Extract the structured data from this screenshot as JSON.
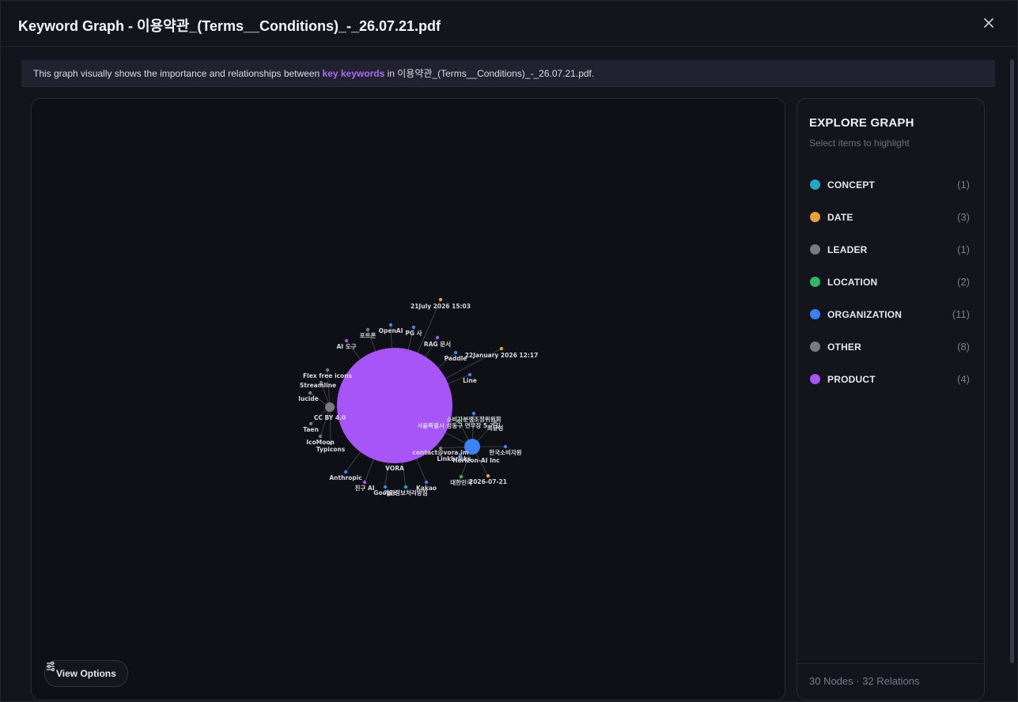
{
  "header": {
    "title": "Keyword Graph - 이용약관_(Terms__Conditions)_-_26.07.21.pdf"
  },
  "info": {
    "prefix": "This graph visually shows the importance and relationships between ",
    "highlight": "key keywords",
    "suffix": " in 이용약관_(Terms__Conditions)_-_26.07.21.pdf."
  },
  "view_options": {
    "label": "View Options"
  },
  "explore": {
    "title": "EXPLORE GRAPH",
    "subtitle": "Select items to highlight",
    "categories": [
      {
        "name": "CONCEPT",
        "count": "(1)",
        "color": "#22a6c5"
      },
      {
        "name": "DATE",
        "count": "(3)",
        "color": "#e8a13b"
      },
      {
        "name": "LEADER",
        "count": "(1)",
        "color": "#7a7a85"
      },
      {
        "name": "LOCATION",
        "count": "(2)",
        "color": "#2eb86b"
      },
      {
        "name": "ORGANIZATION",
        "count": "(11)",
        "color": "#3b82f6"
      },
      {
        "name": "OTHER",
        "count": "(8)",
        "color": "#7a7a85"
      },
      {
        "name": "PRODUCT",
        "count": "(4)",
        "color": "#a855f7"
      }
    ],
    "footer": "30 Nodes · 32 Relations"
  },
  "graph": {
    "nodes": [
      {
        "id": "VORA",
        "label": "VORA",
        "cat": "PRODUCT"
      },
      {
        "id": "CC",
        "label": "CC BY 4.0",
        "cat": "OTHER"
      },
      {
        "id": "HZ",
        "label": "Horizon-AI Inc",
        "cat": "ORGANIZATION"
      },
      {
        "id": "d1",
        "label": "21July 2026 15:03",
        "cat": "DATE"
      },
      {
        "id": "d2",
        "label": "22January 2026 12:17",
        "cat": "DATE"
      },
      {
        "id": "d3",
        "label": "2026-07-21",
        "cat": "DATE"
      },
      {
        "id": "openai",
        "label": "OpenAI",
        "cat": "ORGANIZATION"
      },
      {
        "id": "pg",
        "label": "PG 사",
        "cat": "ORGANIZATION"
      },
      {
        "id": "forum",
        "label": "포트폰",
        "cat": "OTHER"
      },
      {
        "id": "aitool",
        "label": "AI 도구",
        "cat": "PRODUCT"
      },
      {
        "id": "rag",
        "label": "RAG 문서",
        "cat": "PRODUCT"
      },
      {
        "id": "paddle",
        "label": "Paddle",
        "cat": "ORGANIZATION"
      },
      {
        "id": "line",
        "label": "Line",
        "cat": "ORGANIZATION"
      },
      {
        "id": "flex",
        "label": "Flex free icons",
        "cat": "OTHER"
      },
      {
        "id": "stream",
        "label": "Streamline",
        "cat": "OTHER"
      },
      {
        "id": "lucide",
        "label": "lucide",
        "cat": "OTHER"
      },
      {
        "id": "taen",
        "label": "Taen",
        "cat": "OTHER"
      },
      {
        "id": "icomoon",
        "label": "IcoMoon",
        "cat": "OTHER"
      },
      {
        "id": "typicons",
        "label": "Typicons",
        "cat": "OTHER"
      },
      {
        "id": "anthropic",
        "label": "Anthropic",
        "cat": "ORGANIZATION"
      },
      {
        "id": "friend",
        "label": "친구 AI",
        "cat": "PRODUCT"
      },
      {
        "id": "google",
        "label": "Google",
        "cat": "ORGANIZATION"
      },
      {
        "id": "privacy",
        "label": "개인정보처리방침",
        "cat": "CONCEPT"
      },
      {
        "id": "kakao",
        "label": "Kakao",
        "cat": "ORGANIZATION"
      },
      {
        "id": "consumer",
        "label": "소비자분쟁조정위원회",
        "cat": "ORGANIZATION"
      },
      {
        "id": "seoul",
        "label": "서울특별시 성동구 연무장 5 가길",
        "cat": "LOCATION"
      },
      {
        "id": "choi",
        "label": "최윤성",
        "cat": "LEADER"
      },
      {
        "id": "kca",
        "label": "한국소비자원",
        "cat": "ORGANIZATION"
      },
      {
        "id": "contact",
        "label": "contact@vora.im",
        "cat": "OTHER"
      },
      {
        "id": "linkbricks",
        "label": "Linkbricks",
        "cat": "ORGANIZATION"
      },
      {
        "id": "korea",
        "label": "대한민국",
        "cat": "LOCATION"
      }
    ]
  }
}
